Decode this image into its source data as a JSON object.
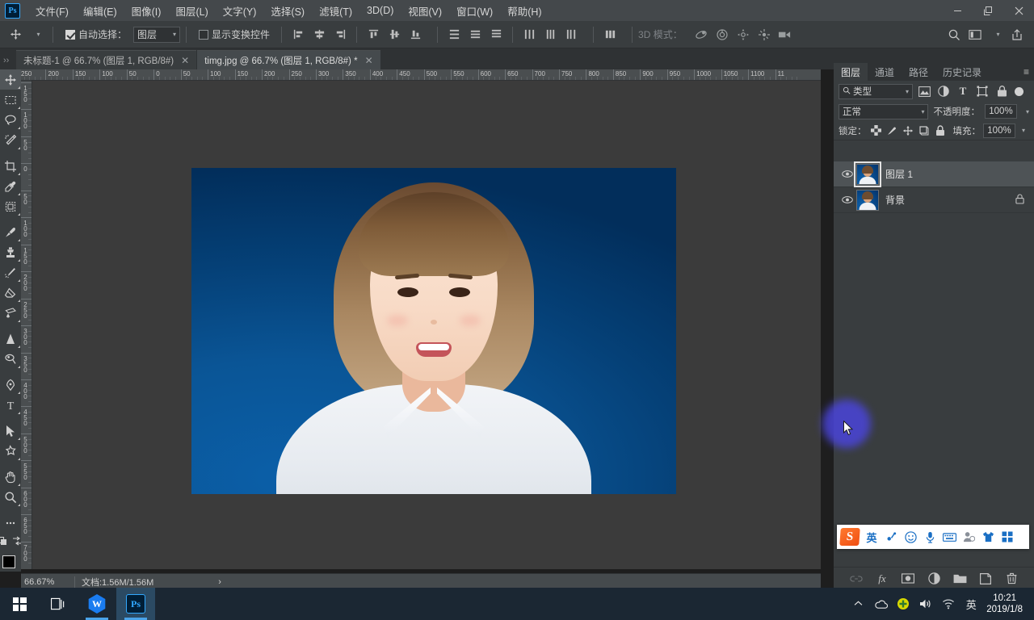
{
  "app": {
    "name": "Adobe Photoshop",
    "logo_text": "Ps"
  },
  "menubar": {
    "items": [
      {
        "label": "文件(F)",
        "name": "menu-file"
      },
      {
        "label": "编辑(E)",
        "name": "menu-edit"
      },
      {
        "label": "图像(I)",
        "name": "menu-image"
      },
      {
        "label": "图层(L)",
        "name": "menu-layer"
      },
      {
        "label": "文字(Y)",
        "name": "menu-type"
      },
      {
        "label": "选择(S)",
        "name": "menu-select"
      },
      {
        "label": "滤镜(T)",
        "name": "menu-filter"
      },
      {
        "label": "3D(D)",
        "name": "menu-3d"
      },
      {
        "label": "视图(V)",
        "name": "menu-view"
      },
      {
        "label": "窗口(W)",
        "name": "menu-window"
      },
      {
        "label": "帮助(H)",
        "name": "menu-help"
      }
    ],
    "window_controls": {
      "minimize": "—",
      "maximize": "❐",
      "close": "✕"
    }
  },
  "options_bar": {
    "tool_icon": "move-tool-icon",
    "auto_select_checked": true,
    "auto_select_label": "自动选择：",
    "auto_select_value": "图层",
    "show_transform_label": "显示变换控件",
    "show_transform_checked": false,
    "mode_3d_label": "3D 模式：",
    "search_icon": "search-icon",
    "arrange_icon": "arrange-documents-icon",
    "share_icon": "share-icon"
  },
  "tabs": [
    {
      "label": "未标题-1 @ 66.7% (图层 1, RGB/8#)",
      "active": false,
      "close": "✕"
    },
    {
      "label": "timg.jpg @ 66.7% (图层 1, RGB/8#) *",
      "active": true,
      "close": "✕"
    }
  ],
  "toolbar": {
    "tools": [
      {
        "name": "move-tool",
        "glyph": "✥",
        "active": true
      },
      {
        "name": "marquee-tool",
        "glyph": "▢",
        "active": false
      },
      {
        "name": "lasso-tool",
        "glyph": "◯",
        "active": false
      },
      {
        "name": "magic-wand-tool",
        "glyph": "✦",
        "active": false
      },
      {
        "name": "crop-tool",
        "glyph": "⌗",
        "active": false
      },
      {
        "name": "eyedropper-tool",
        "glyph": "✎",
        "active": false
      },
      {
        "name": "frame-tool",
        "glyph": "▣",
        "active": false
      },
      {
        "name": "brush-tool",
        "glyph": "🖌",
        "active": false
      },
      {
        "name": "clone-stamp-tool",
        "glyph": "⚱",
        "active": false
      },
      {
        "name": "history-brush-tool",
        "glyph": "✧",
        "active": false
      },
      {
        "name": "eraser-tool",
        "glyph": "▰",
        "active": false
      },
      {
        "name": "gradient-tool",
        "glyph": "◨",
        "active": false
      },
      {
        "name": "blur-tool",
        "glyph": "▲",
        "active": false
      },
      {
        "name": "dodge-tool",
        "glyph": "◉",
        "active": false
      },
      {
        "name": "pen-tool",
        "glyph": "✒",
        "active": false
      },
      {
        "name": "type-tool",
        "glyph": "T",
        "active": false
      },
      {
        "name": "path-selection-tool",
        "glyph": "➤",
        "active": false
      },
      {
        "name": "shape-tool",
        "glyph": "✶",
        "active": false
      },
      {
        "name": "hand-tool",
        "glyph": "✋",
        "active": false
      },
      {
        "name": "zoom-tool",
        "glyph": "⌕",
        "active": false
      },
      {
        "name": "edit-toolbar",
        "glyph": "•••",
        "active": false
      }
    ],
    "quickmask_icon": "quick-mask-icon",
    "screenmode_icon": "screen-mode-icon",
    "foreground_color": "#000000",
    "background_color": "#ffffff"
  },
  "rulers": {
    "unit": "px",
    "horizontal_ticks": [
      "250",
      "200",
      "150",
      "100",
      "50",
      "0",
      "50",
      "100",
      "150",
      "200",
      "250",
      "300",
      "350",
      "400",
      "450",
      "500",
      "550",
      "600",
      "650",
      "700",
      "750",
      "800",
      "850",
      "900",
      "950",
      "1000",
      "1050",
      "1100",
      "11"
    ],
    "vertical_ticks": [
      "150",
      "100",
      "50",
      "0",
      "50",
      "100",
      "150",
      "200",
      "250",
      "300",
      "350",
      "400",
      "450",
      "500",
      "550",
      "600",
      "650",
      "700"
    ]
  },
  "statusbar": {
    "zoom": "66.67%",
    "doc_info": "文档:1.56M/1.56M",
    "expand_arrow": "›"
  },
  "panels": {
    "tabs": [
      {
        "label": "图层",
        "active": true,
        "name": "panel-tab-layers"
      },
      {
        "label": "通道",
        "active": false,
        "name": "panel-tab-channels"
      },
      {
        "label": "路径",
        "active": false,
        "name": "panel-tab-paths"
      },
      {
        "label": "历史记录",
        "active": false,
        "name": "panel-tab-history"
      }
    ],
    "menu_glyph": "≡",
    "filter": {
      "search_icon": "search-icon",
      "kind_label": "类型",
      "icons": [
        "filter-pixel-icon",
        "filter-adjustment-icon",
        "filter-type-icon",
        "filter-shape-icon",
        "filter-smart-icon"
      ],
      "toggle": "filter-enable-toggle"
    },
    "blend": {
      "mode": "正常",
      "opacity_label": "不透明度：",
      "opacity_value": "100%"
    },
    "lock": {
      "label": "锁定：",
      "icons": [
        "lock-transparent-icon",
        "lock-image-icon",
        "lock-position-icon",
        "lock-artboard-icon",
        "lock-all-icon"
      ],
      "fill_label": "填充：",
      "fill_value": "100%"
    },
    "layers": [
      {
        "name": "图层 1",
        "visible": true,
        "selected": true,
        "locked": false
      },
      {
        "name": "背景",
        "visible": true,
        "selected": false,
        "locked": true
      }
    ],
    "footer_buttons": [
      {
        "name": "link-layers-button",
        "glyph": "🔗",
        "dim": true
      },
      {
        "name": "layer-style-button",
        "glyph": "fx",
        "dim": false
      },
      {
        "name": "layer-mask-button",
        "glyph": "◙",
        "dim": false
      },
      {
        "name": "adjustment-layer-button",
        "glyph": "◐",
        "dim": false
      },
      {
        "name": "new-group-button",
        "glyph": "🗀",
        "dim": false
      },
      {
        "name": "new-layer-button",
        "glyph": "🗋",
        "dim": false
      },
      {
        "name": "delete-layer-button",
        "glyph": "🗑",
        "dim": false
      }
    ]
  },
  "ime": {
    "name": "搜狗输入法",
    "logo": "S",
    "mode": "英",
    "items": [
      "voice-input-icon",
      "emoji-icon",
      "mic-icon",
      "keyboard-icon",
      "user-icon",
      "skin-icon",
      "toolbox-icon"
    ]
  },
  "canvas": {
    "document": "timg.jpg",
    "image_alt": "蓝底证件照",
    "background_hex": "#0a5596"
  },
  "taskbar": {
    "start": "windows-start-icon",
    "taskview": "task-view-icon",
    "apps": [
      {
        "name": "wps-taskbar-button",
        "glyph": "W",
        "running": true,
        "active": false
      },
      {
        "name": "photoshop-taskbar-button",
        "glyph": "Ps",
        "running": true,
        "active": true
      }
    ],
    "tray": [
      {
        "name": "onedrive-tray-icon",
        "glyph": "☁"
      },
      {
        "name": "security-tray-icon",
        "glyph": "✚"
      },
      {
        "name": "volume-tray-icon",
        "glyph": "🔊"
      },
      {
        "name": "network-tray-icon",
        "glyph": "◗"
      },
      {
        "name": "ime-tray-icon",
        "glyph": "英"
      }
    ],
    "clock_time": "10:21",
    "clock_date": "2019/1/8"
  }
}
